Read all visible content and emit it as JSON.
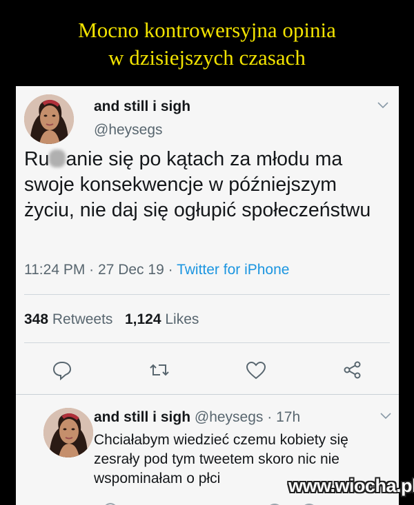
{
  "meme": {
    "title_line1": "Mocno kontrowersyjna opinia",
    "title_line2": "w dzisiejszych czasach"
  },
  "tweet": {
    "display_name": "and still i sigh",
    "handle": "@heysegs",
    "text_before_censor": "Ru",
    "text_after_censor": "anie się po kątach za młodu ma swoje konsekwencje w późniejszym życiu, nie daj się ogłupić społeczeństwu",
    "time": "11:24 PM",
    "separator": "·",
    "date": "27 Dec 19",
    "source": "Twitter for iPhone",
    "retweets_count": "348",
    "retweets_label": "Retweets",
    "likes_count": "1,124",
    "likes_label": "Likes",
    "actions": [
      "reply-icon",
      "retweet-icon",
      "like-icon",
      "share-icon"
    ]
  },
  "reply": {
    "display_name": "and still i sigh",
    "handle": "@heysegs",
    "separator": "·",
    "age": "17h",
    "text": "Chciałabym wiedzieć czemu kobiety się zesrały pod tym tweetem skoro nic nie wspominałam o płci"
  },
  "watermark": "www.wiocha.pl",
  "colors": {
    "title": "#f2e300",
    "link": "#1b95e0",
    "muted": "#58666f",
    "text": "#14171a",
    "card": "#f6f6f6"
  }
}
